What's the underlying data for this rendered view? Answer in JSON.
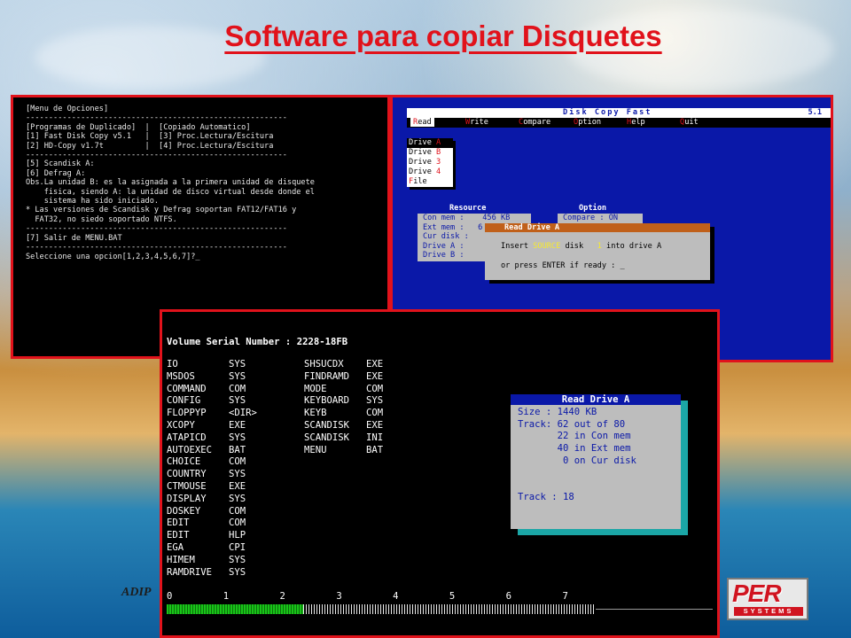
{
  "slide": {
    "title": "Software para copiar Disquetes",
    "footer_text": "ADIP",
    "logo_main": "PER",
    "logo_sub": "SYSTEMS"
  },
  "menu_screen": {
    "lines": [
      "[Menu de Opciones]",
      "---------------------------------------------------------",
      "[Programas de Duplicado]  |  [Copiado Automatico]",
      "[1] Fast Disk Copy v5.1   |  [3] Proc.Lectura/Escitura",
      "[2] HD-Copy v1.7t         |  [4] Proc.Lectura/Escitura",
      "---------------------------------------------------------",
      "[5] Scandisk A:",
      "[6] Defrag A:",
      "",
      "Obs.La unidad B: es la asignada a la primera unidad de disquete",
      "    fisica, siendo A: la unidad de disco virtual desde donde el",
      "    sistema ha sido iniciado.",
      "",
      "* Las versiones de Scandisk y Defrag soportan FAT12/FAT16 y",
      "  FAT32, no siedo soportado NTFS.",
      "---------------------------------------------------------",
      "[7] Salir de MENU.BAT",
      "---------------------------------------------------------",
      "",
      "Seleccione una opcion[1,2,3,4,5,6,7]?_"
    ]
  },
  "disk_copy_fast": {
    "title": "Disk  Copy  Fast",
    "version": "5.1",
    "menu": [
      {
        "hot": "R",
        "rest": "ead"
      },
      {
        "hot": "W",
        "rest": "rite"
      },
      {
        "hot": "C",
        "rest": "ompare"
      },
      {
        "hot": "O",
        "rest": "ption"
      },
      {
        "hot": "H",
        "rest": "elp"
      },
      {
        "hot": "Q",
        "rest": "uit"
      }
    ],
    "drive_menu": [
      {
        "label": "Drive ",
        "hot": "A"
      },
      {
        "label": "Drive ",
        "hot": "B"
      },
      {
        "label": "Drive ",
        "hot": "3"
      },
      {
        "label": "Drive ",
        "hot": "4"
      },
      {
        "label": "",
        "hot": "F",
        "rest": "ile"
      }
    ],
    "resource_title": "Resource",
    "resource_lines": [
      "Con mem :    456 KB",
      "Ext mem :   6",
      "Cur disk :",
      "Drive A :",
      "Drive B :"
    ],
    "option_title": "Option",
    "option_lines": [
      "Compare : ON"
    ],
    "dialog": {
      "title": "Read  Drive A",
      "line1_pre": "Insert ",
      "line1_hl1": "SOURCE",
      "line1_mid": " disk   ",
      "line1_hl2": "1",
      "line1_post": " into drive A",
      "line2": "or press ENTER if ready : _"
    }
  },
  "dir_screen": {
    "serial": "Volume Serial Number : 2228-18FB",
    "rows": [
      [
        "IO",
        "SYS",
        "SHSUCDX",
        "EXE"
      ],
      [
        "MSDOS",
        "SYS",
        "FINDRAMD",
        "EXE"
      ],
      [
        "COMMAND",
        "COM",
        "MODE",
        "COM"
      ],
      [
        "CONFIG",
        "SYS",
        "KEYBOARD",
        "SYS"
      ],
      [
        "FLOPPYP",
        "<DIR>",
        "KEYB",
        "COM"
      ],
      [
        "XCOPY",
        "EXE",
        "SCANDISK",
        "EXE"
      ],
      [
        "ATAPICD",
        "SYS",
        "SCANDISK",
        "INI"
      ],
      [
        "AUTOEXEC",
        "BAT",
        "MENU",
        "BAT"
      ],
      [
        "CHOICE",
        "COM",
        "",
        ""
      ],
      [
        "COUNTRY",
        "SYS",
        "",
        ""
      ],
      [
        "CTMOUSE",
        "EXE",
        "",
        ""
      ],
      [
        "DISPLAY",
        "SYS",
        "",
        ""
      ],
      [
        "DOSKEY",
        "COM",
        "",
        ""
      ],
      [
        "EDIT",
        "COM",
        "",
        ""
      ],
      [
        "EDIT",
        "HLP",
        "",
        ""
      ],
      [
        "EGA",
        "CPI",
        "",
        ""
      ],
      [
        "HIMEM",
        "SYS",
        "",
        ""
      ],
      [
        "RAMDRIVE",
        "SYS",
        "",
        ""
      ]
    ],
    "ticks": "0         1         2         3         4         5         6         7",
    "track_progress": {
      "done_fraction": 0.25,
      "read_fraction": 0.785
    },
    "status_box": {
      "title": "Read  Drive A",
      "lines": [
        "Size : 1440 KB",
        "Track: 62 out of 80",
        "       22 in Con mem",
        "       40 in Ext mem",
        "        0 on Cur disk",
        "",
        "",
        "Track : 18"
      ]
    }
  }
}
